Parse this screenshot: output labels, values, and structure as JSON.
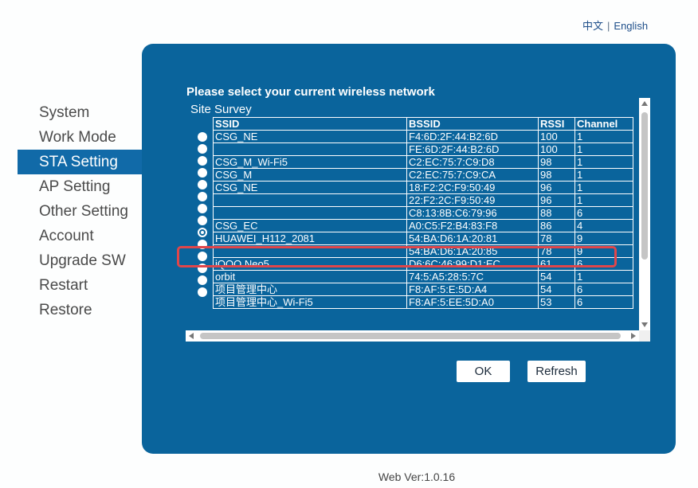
{
  "language": {
    "chinese": "中文",
    "separator": "|",
    "english": "English"
  },
  "sidebar": {
    "items": [
      {
        "label": "System",
        "active": false
      },
      {
        "label": "Work Mode",
        "active": false
      },
      {
        "label": "STA Setting",
        "active": true
      },
      {
        "label": "AP Setting",
        "active": false
      },
      {
        "label": "Other Setting",
        "active": false
      },
      {
        "label": "Account",
        "active": false
      },
      {
        "label": "Upgrade SW",
        "active": false
      },
      {
        "label": "Restart",
        "active": false
      },
      {
        "label": "Restore",
        "active": false
      }
    ]
  },
  "main": {
    "heading": "Please select your current wireless network",
    "survey_title": "Site Survey",
    "columns": [
      "SSID",
      "BSSID",
      "RSSI",
      "Channel"
    ],
    "rows": [
      {
        "ssid": "CSG_NE",
        "bssid": "F4:6D:2F:44:B2:6D",
        "rssi": "100",
        "channel": "1"
      },
      {
        "ssid": "",
        "bssid": "FE:6D:2F:44:B2:6D",
        "rssi": "100",
        "channel": "1"
      },
      {
        "ssid": "CSG_M_Wi-Fi5",
        "bssid": "C2:EC:75:7:C9:D8",
        "rssi": "98",
        "channel": "1"
      },
      {
        "ssid": "CSG_M",
        "bssid": "C2:EC:75:7:C9:CA",
        "rssi": "98",
        "channel": "1"
      },
      {
        "ssid": "CSG_NE",
        "bssid": "18:F2:2C:F9:50:49",
        "rssi": "96",
        "channel": "1"
      },
      {
        "ssid": "",
        "bssid": "22:F2:2C:F9:50:49",
        "rssi": "96",
        "channel": "1"
      },
      {
        "ssid": "",
        "bssid": "C8:13:8B:C6:79:96",
        "rssi": "88",
        "channel": "6"
      },
      {
        "ssid": "CSG_EC",
        "bssid": "A0:C5:F2:B4:83:F8",
        "rssi": "86",
        "channel": "4"
      },
      {
        "ssid": "HUAWEI_H112_2081",
        "bssid": "54:BA:D6:1A:20:81",
        "rssi": "78",
        "channel": "9"
      },
      {
        "ssid": "",
        "bssid": "54:BA:D6:1A:20:85",
        "rssi": "78",
        "channel": "9"
      },
      {
        "ssid": "iQOO Neo5",
        "bssid": "D6:6C:46:99:D1:EC",
        "rssi": "61",
        "channel": "6"
      },
      {
        "ssid": "orbit",
        "bssid": "74:5:A5:28:5:7C",
        "rssi": "54",
        "channel": "1"
      },
      {
        "ssid": "项目管理中心",
        "bssid": "F8:AF:5:E:5D:A4",
        "rssi": "54",
        "channel": "6"
      },
      {
        "ssid": "项目管理中心_Wi-Fi5",
        "bssid": "F8:AF:5:EE:5D:A0",
        "rssi": "53",
        "channel": "6"
      }
    ],
    "selected_index": 8,
    "ok_label": "OK",
    "refresh_label": "Refresh"
  },
  "footer": {
    "version": "Web Ver:1.0.16"
  }
}
